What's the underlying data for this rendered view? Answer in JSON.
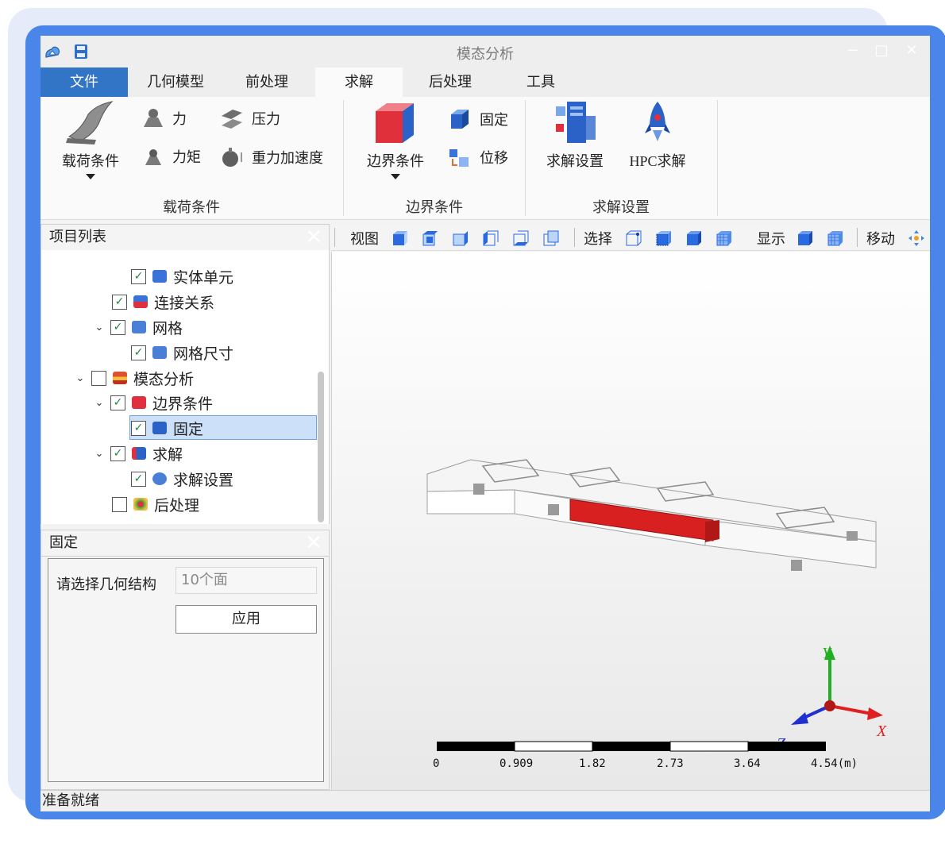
{
  "window": {
    "title": "模态分析"
  },
  "tabs": [
    {
      "label": "文件"
    },
    {
      "label": "几何模型"
    },
    {
      "label": "前处理"
    },
    {
      "label": "求解"
    },
    {
      "label": "后处理"
    },
    {
      "label": "工具"
    }
  ],
  "ribbon": {
    "load": {
      "big": "载荷条件",
      "force": "力",
      "pressure": "压力",
      "moment": "力矩",
      "gravity": "重力加速度",
      "group": "载荷条件"
    },
    "boundary": {
      "big": "边界条件",
      "fixed": "固定",
      "displacement": "位移",
      "group": "边界条件"
    },
    "solve": {
      "settings": "求解设置",
      "hpc": "HPC求解",
      "group": "求解设置"
    }
  },
  "project": {
    "title": "项目列表",
    "items": [
      {
        "label": "实体单元",
        "checked": true
      },
      {
        "label": "连接关系",
        "checked": true
      },
      {
        "label": "网格",
        "checked": true
      },
      {
        "label": "网格尺寸",
        "checked": true
      },
      {
        "label": "模态分析",
        "checked": false
      },
      {
        "label": "边界条件",
        "checked": true
      },
      {
        "label": "固定",
        "checked": true
      },
      {
        "label": "求解",
        "checked": true
      },
      {
        "label": "求解设置",
        "checked": true
      },
      {
        "label": "后处理",
        "checked": false
      }
    ]
  },
  "props": {
    "title": "固定",
    "geom_label": "请选择几何结构",
    "geom_value": "10个面",
    "apply": "应用"
  },
  "toolbar": {
    "view": "视图",
    "select": "选择",
    "display": "显示",
    "move": "移动"
  },
  "axes": {
    "x": "X",
    "y": "Y",
    "z": "Z"
  },
  "scale": {
    "ticks": [
      "0",
      "0.909",
      "1.82",
      "2.73",
      "3.64",
      "4.54(m)"
    ]
  },
  "status": "准备就绪",
  "colors": {
    "accent": "#3274c6",
    "frame": "#4a86ea",
    "highlight": "#d42020"
  }
}
